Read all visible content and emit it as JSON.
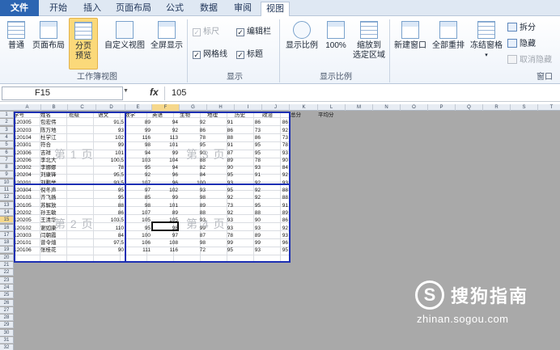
{
  "tabs": [
    {
      "label": "文件"
    },
    {
      "label": "开始"
    },
    {
      "label": "插入"
    },
    {
      "label": "页面布局"
    },
    {
      "label": "公式"
    },
    {
      "label": "数据"
    },
    {
      "label": "审阅"
    },
    {
      "label": "视图"
    }
  ],
  "ribbon": {
    "normal": "普通",
    "page_layout": "页面布局",
    "page_break_l1": "分页",
    "page_break_l2": "预览",
    "custom_view": "自定义视图",
    "full_screen": "全屏显示",
    "group_workbook_views": "工作簿视图",
    "ruler": "标尺",
    "gridlines": "网格线",
    "formula_bar": "编辑栏",
    "headings": "标题",
    "group_show": "显示",
    "zoom": "显示比例",
    "zoom100": "100%",
    "zoom_sel_l1": "缩放到",
    "zoom_sel_l2": "选定区域",
    "group_zoom": "显示比例",
    "new_window": "新建窗口",
    "arrange_all": "全部重排",
    "freeze": "冻结窗格",
    "split": "拆分",
    "hide": "隐藏",
    "unhide": "取消隐藏",
    "group_window": "窗口"
  },
  "formula_bar": {
    "cell_ref": "F15",
    "fx": "fx",
    "value": "105"
  },
  "columns": [
    "A",
    "B",
    "C",
    "D",
    "E",
    "F",
    "G",
    "H",
    "I",
    "J",
    "K",
    "L",
    "M",
    "N",
    "O",
    "P",
    "Q",
    "R",
    "S",
    "T"
  ],
  "rows": [
    "1",
    "2",
    "3",
    "4",
    "5",
    "6",
    "7",
    "8",
    "9",
    "10",
    "11",
    "12",
    "13",
    "14",
    "15",
    "16",
    "17",
    "18",
    "19",
    "20",
    "21",
    "22",
    "23",
    "24",
    "25",
    "26",
    "27",
    "28",
    "29",
    "30",
    "31",
    "32",
    "33"
  ],
  "headers": [
    "学号",
    "姓名",
    "班级",
    "语文",
    "数学",
    "英语",
    "生物",
    "地理",
    "历史",
    "政治",
    "总分",
    "平均分"
  ],
  "table": [
    [
      "120305",
      "包宏伟",
      "91.5",
      "89",
      "94",
      "92",
      "91",
      "86",
      "86"
    ],
    [
      "120203",
      "陈万地",
      "93",
      "99",
      "92",
      "86",
      "86",
      "73",
      "92"
    ],
    [
      "120104",
      "杜学江",
      "102",
      "116",
      "113",
      "78",
      "88",
      "86",
      "73"
    ],
    [
      "120301",
      "符合",
      "99",
      "98",
      "101",
      "95",
      "91",
      "95",
      "78"
    ],
    [
      "120306",
      "吉祥",
      "101",
      "94",
      "99",
      "90",
      "87",
      "95",
      "93"
    ],
    [
      "120206",
      "李北大",
      "100.5",
      "103",
      "104",
      "88",
      "89",
      "78",
      "90"
    ],
    [
      "120302",
      "李娜娜",
      "78",
      "95",
      "94",
      "82",
      "90",
      "93",
      "84"
    ],
    [
      "120204",
      "刘康锋",
      "95.5",
      "92",
      "96",
      "84",
      "95",
      "91",
      "92"
    ],
    [
      "120201",
      "刘鹏举",
      "93.5",
      "107",
      "96",
      "100",
      "93",
      "92",
      "93"
    ],
    [
      "120304",
      "倪冬声",
      "95",
      "97",
      "102",
      "93",
      "95",
      "92",
      "88"
    ],
    [
      "120103",
      "齐飞扬",
      "95",
      "85",
      "99",
      "98",
      "92",
      "92",
      "88"
    ],
    [
      "120105",
      "苏解放",
      "88",
      "98",
      "101",
      "89",
      "73",
      "95",
      "91"
    ],
    [
      "120202",
      "孙玉敏",
      "86",
      "107",
      "89",
      "88",
      "92",
      "88",
      "89"
    ],
    [
      "120205",
      "王清华",
      "103.5",
      "105",
      "105",
      "93",
      "93",
      "90",
      "86"
    ],
    [
      "120102",
      "谢如康",
      "110",
      "95",
      "98",
      "99",
      "93",
      "93",
      "92"
    ],
    [
      "120303",
      "闫朝霞",
      "84",
      "100",
      "97",
      "87",
      "78",
      "89",
      "93"
    ],
    [
      "120101",
      "曾令煊",
      "97.5",
      "106",
      "108",
      "98",
      "99",
      "99",
      "96"
    ],
    [
      "120106",
      "张桂花",
      "90",
      "111",
      "116",
      "72",
      "95",
      "93",
      "95"
    ]
  ],
  "page_labels": [
    "第 1 页",
    "第 3 页",
    "第 2 页",
    "第 4 页"
  ],
  "watermark": {
    "logo_char": "S",
    "text": "搜狗指南",
    "url": "zhinan.sogou.com"
  }
}
